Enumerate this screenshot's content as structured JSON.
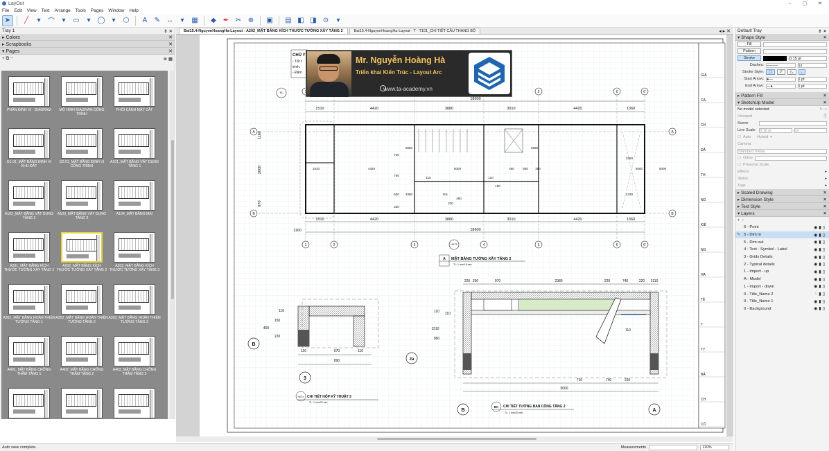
{
  "app": {
    "title": "LayOut",
    "window_controls": [
      "–",
      "▢",
      "✕"
    ]
  },
  "menu": [
    "File",
    "Edit",
    "View",
    "Text",
    "Arrange",
    "Tools",
    "Pages",
    "Window",
    "Help"
  ],
  "tray": {
    "title": "Tray 1",
    "sections": {
      "colors": "Colors",
      "scrapbooks": "Scrapbooks",
      "pages": "Pages"
    }
  },
  "pages": [
    {
      "label": "PHÂN ĐỊNH VỊ - DIAGRAM"
    },
    {
      "label": "MÔ HÌNH DIAGRAM CÔNG TRÌNH"
    },
    {
      "label": "PHỐI CẢNH MẶT CẮT"
    },
    {
      "label": "D1.01_MẶT BẰNG ĐỊNH VỊ KHU ĐẤT"
    },
    {
      "label": "D2.01_MẶT BẰNG ĐỊNH VỊ CÔNG TRÌNH"
    },
    {
      "label": "A101_MẶT BẰNG VẬT DỤNG TẦNG 1"
    },
    {
      "label": "A102_MẶT BẰNG VẬT DỤNG TẦNG 2"
    },
    {
      "label": "A103_MẶT BẰNG VẬT DỤNG TẦNG 3"
    },
    {
      "label": "A104_MẶT BẰNG MÁI"
    },
    {
      "label": "A201_MẶT BẰNG KÍCH THƯỚC TƯỜNG XÂY TẦNG 1"
    },
    {
      "label": "A202_MẶT BẰNG KÍCH THƯỚC TƯỜNG XÂY TẦNG 2",
      "selected": true
    },
    {
      "label": "A203_MẶT BẰNG KÍCH THƯỚC TƯỜNG XÂY TẦNG 3"
    },
    {
      "label": "A301_MẶT BẰNG HOÀN THIỆN TƯỜNG TẦNG 1"
    },
    {
      "label": "A302_MẶT BẰNG HOÀN THIỆN TƯỜNG TẦNG 2"
    },
    {
      "label": "A303_MẶT BẰNG HOÀN THIỆN TƯỜNG TẦNG 3"
    },
    {
      "label": "A401_MẶT BẰNG CHỐNG THẤM TẦNG 1"
    },
    {
      "label": "A402_MẶT BẰNG CHỐNG THẤM TẦNG 2"
    },
    {
      "label": "A403_MẶT BẰNG CHỐNG THẤM TẦNG 3"
    },
    {
      "label": ""
    },
    {
      "label": ""
    },
    {
      "label": ""
    }
  ],
  "tabs": [
    "Bai15.4-NguyenHoangHa-Layout - A202_MẶT BẰNG KÍCH THƯỚC TƯỜNG XÂY TẦNG 2",
    "Bai15.4-NguyenHoangHa-Layout - T - T101_CHI TIẾT CẦU THANG BỘ"
  ],
  "status": {
    "autosave": "Auto save complete.",
    "measurements": "Measurements",
    "zoom": "110%"
  },
  "banner": {
    "name": "Mr. Nguyễn Hoàng Hà",
    "subtitle": "Triển khai Kiến Trúc - Layout Arc",
    "website": "www.ta-academy.vn"
  },
  "drawing": {
    "note": {
      "title": "CHÚ Y",
      "lines": [
        "- Tất c",
        "trình.",
        "- Đảm"
      ]
    },
    "top_dims": [
      "1510",
      "4420",
      "3880",
      "3010",
      "4420",
      "1360"
    ],
    "top_total": "18600",
    "bottom_total": "18600",
    "bottom_dims": [
      "1510",
      "4420",
      "3880",
      "3010",
      "4420",
      "1360"
    ],
    "left_dims": [
      "1160",
      "2600",
      "970"
    ],
    "grid_top": [
      "1",
      "2",
      "3",
      "4",
      "5",
      "6",
      "6'"
    ],
    "grid_left": [
      "A",
      "B"
    ],
    "inner_dims": [
      "1510",
      "4420",
      "5000",
      "490",
      "800",
      "380",
      "110",
      "160",
      "110",
      "2650",
      "2650",
      "3360",
      "3360",
      "4330",
      "5000",
      "5000",
      "720",
      "760",
      "600",
      "230",
      "460",
      "230",
      "115"
    ],
    "plan_title": "MẶT BẰNG TƯỜNG XÂY TẦNG 2",
    "plan_tag": "A",
    "plan_scale": "TL: 1 mm/15 mm",
    "section1": {
      "marker": "B",
      "label": "3",
      "dims": [
        "110",
        "670",
        "110",
        "890",
        "400",
        "220",
        "150",
        "110"
      ],
      "title": "CHI TIẾT HỘP KỸ THUẬT 3",
      "tag": "HKT3",
      "scale": "TL: 1 mm/20 mm"
    },
    "section2": {
      "marker": "2a",
      "dims": [
        "220",
        "250",
        "970",
        "2380",
        "220",
        "740",
        "220",
        "3110",
        "710",
        "740",
        "220",
        "5000",
        "1510",
        "110",
        "960",
        "110",
        "110"
      ],
      "title": "CHI TIẾT TƯỜNG BAN CÔNG TẦNG 2",
      "tag": "BC",
      "scale": "TL: 1 mm/20 mm",
      "grid": [
        "B",
        "A"
      ]
    },
    "title_block_labels": [
      "GIÁ",
      "CA",
      "CH",
      "ĐÃ",
      "TH",
      "NG",
      "KIỂ",
      "NG",
      "HA",
      "TÊ",
      "T",
      "TY",
      "BẢ",
      "CH",
      "CÔ"
    ]
  },
  "default_tray": {
    "title": "Default Tray",
    "shape_style": {
      "title": "Shape Style",
      "fill": "Fill",
      "pattern": "Pattern",
      "stroke": "Stroke",
      "stroke_val": "0.15 pt",
      "dashes": "Dashes:",
      "dash_scale": "1x",
      "stroke_style": "Stroke Style:",
      "start_arrow": "Start Arrow:",
      "start_size": "1 pt",
      "end_arrow": "End Arrow:",
      "end_size": "1 pt"
    },
    "pattern_fill": "Pattern Fill",
    "sketchup": {
      "title": "SketchUp Model",
      "none": "No model selected",
      "viewport": "Viewport",
      "scene": "Scene",
      "line_scale": "Line Scale",
      "line_val": "0.10 pt",
      "line_mult": "1x",
      "auto": "Auto",
      "hybrid": "Hybrid",
      "camera": "Camera",
      "std_views": "Standard Views",
      "ortho": "Ortho",
      "preserve": "Preserve Scale",
      "effects": "Effects",
      "styles": "Styles",
      "tags": "Tags"
    },
    "scaled_drawing": "Scaled Drawing",
    "dimension_style": "Dimension Style",
    "text_style": "Text Style",
    "layers": {
      "title": "Layers",
      "items": [
        "6 - Point",
        "5 - Dim in",
        "5 - Dim out",
        "4 - Text - Symbol - Label",
        "3 - Grids Details",
        "2 - Typical details",
        "1 - Import - up",
        "A - Model",
        "1 - Import - down",
        "0 - Title_Name 2",
        "0 - Title_Name 1",
        "0 - Background"
      ],
      "selected": 1
    }
  }
}
